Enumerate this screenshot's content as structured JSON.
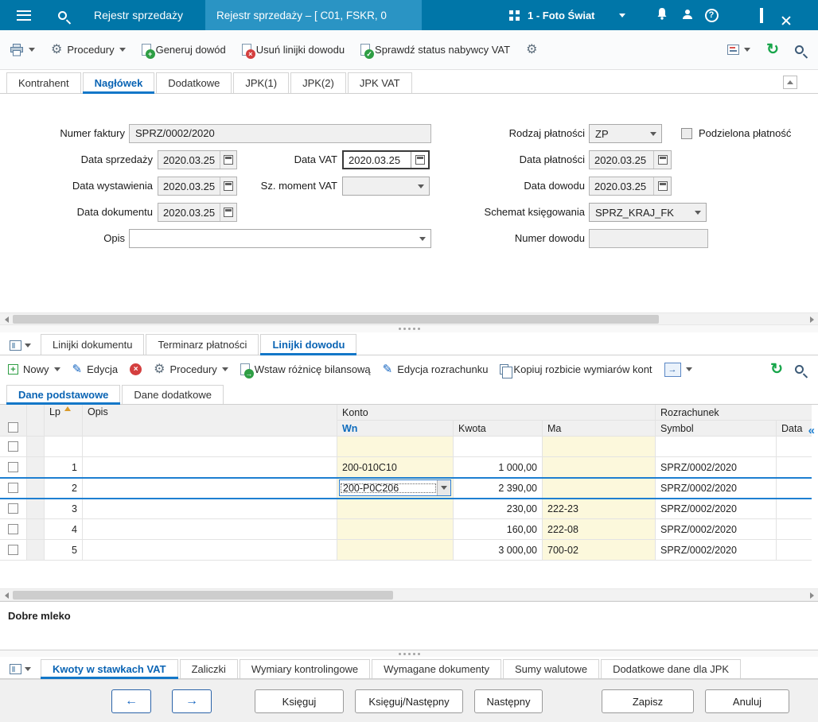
{
  "colors": {
    "titlebar": "#0076a8",
    "titlebar_active_tab": "#2a94c4",
    "accent_blue": "#1377c8",
    "selection_border": "#1e7fd1",
    "editable_cell_yellow": "#fcf8dc",
    "toolbar_green": "#2e9e44",
    "toolbar_red": "#d43f3f",
    "refresh_green": "#17a54a"
  },
  "titlebar": {
    "app_title": "Rejestr sprzedaży",
    "document_tab": "Rejestr sprzedaży – [ C01, FSKR, 0",
    "company": "1 - Foto Świat"
  },
  "toolbar": {
    "procedury": "Procedury",
    "generuj_dowod": "Generuj dowód",
    "usun_linijki_dowodu": "Usuń linijki dowodu",
    "sprawdz_status": "Sprawdź status nabywcy VAT"
  },
  "header_tabs": {
    "kontrahent": "Kontrahent",
    "naglowek": "Nagłówek",
    "dodatkowe": "Dodatkowe",
    "jpk1": "JPK(1)",
    "jpk2": "JPK(2)",
    "jpk_vat": "JPK VAT"
  },
  "form": {
    "numer_faktury_label": "Numer faktury",
    "numer_faktury_value": "SPRZ/0002/2020",
    "data_sprzedazy_label": "Data sprzedaży",
    "data_sprzedazy_value": "2020.03.25",
    "data_vat_label": "Data VAT",
    "data_vat_value": "2020.03.25",
    "data_wystawienia_label": "Data wystawienia",
    "data_wystawienia_value": "2020.03.25",
    "sz_moment_vat_label": "Sz. moment VAT",
    "sz_moment_vat_value": "",
    "data_dokumentu_label": "Data dokumentu",
    "data_dokumentu_value": "2020.03.25",
    "opis_label": "Opis",
    "opis_value": "",
    "rodzaj_platnosci_label": "Rodzaj płatności",
    "rodzaj_platnosci_value": "ZP",
    "podzielona_platnosc_label": "Podzielona płatność",
    "data_platnosci_label": "Data płatności",
    "data_platnosci_value": "2020.03.25",
    "data_dowodu_label": "Data dowodu",
    "data_dowodu_value": "2020.03.25",
    "schemat_ksiegowania_label": "Schemat księgowania",
    "schemat_ksiegowania_value": "SPRZ_KRAJ_FK",
    "numer_dowodu_label": "Numer dowodu",
    "numer_dowodu_value": ""
  },
  "middle_tabs": {
    "linijki_dokumentu": "Linijki dokumentu",
    "terminarz_platnosci": "Terminarz płatności",
    "linijki_dowodu": "Linijki dowodu"
  },
  "grid_toolbar": {
    "nowy": "Nowy",
    "edycja": "Edycja",
    "procedury": "Procedury",
    "wstaw_roznice": "Wstaw różnicę bilansową",
    "edycja_rozrachunku": "Edycja rozrachunku",
    "kopiuj_rozbicie": "Kopiuj rozbicie wymiarów kont"
  },
  "grid_subtabs": {
    "dane_podstawowe": "Dane podstawowe",
    "dane_dodatkowe": "Dane dodatkowe"
  },
  "grid": {
    "headers": {
      "lp": "Lp",
      "opis": "Opis",
      "konto": "Konto",
      "rozrachunek": "Rozrachunek",
      "wn": "Wn",
      "kwota": "Kwota",
      "ma": "Ma",
      "symbol": "Symbol",
      "data": "Data"
    },
    "rows": [
      {
        "lp": "1",
        "opis": "",
        "wn": "200-010C10",
        "kwota": "1 000,00",
        "ma": "",
        "symbol": "SPRZ/0002/2020"
      },
      {
        "lp": "2",
        "opis": "",
        "wn": "200-P0C206",
        "kwota": "2 390,00",
        "ma": "",
        "symbol": "SPRZ/0002/2020"
      },
      {
        "lp": "3",
        "opis": "",
        "wn": "",
        "kwota": "230,00",
        "ma": "222-23",
        "symbol": "SPRZ/0002/2020"
      },
      {
        "lp": "4",
        "opis": "",
        "wn": "",
        "kwota": "160,00",
        "ma": "222-08",
        "symbol": "SPRZ/0002/2020"
      },
      {
        "lp": "5",
        "opis": "",
        "wn": "",
        "kwota": "3 000,00",
        "ma": "700-02",
        "symbol": "SPRZ/0002/2020"
      }
    ],
    "note": "Dobre mleko"
  },
  "bottom_tabs": {
    "kwoty_vat": "Kwoty w stawkach VAT",
    "zaliczki": "Zaliczki",
    "wymiary": "Wymiary kontrolingowe",
    "wymagane": "Wymagane dokumenty",
    "sumy": "Sumy walutowe",
    "dodatkowe_jpk": "Dodatkowe dane dla JPK"
  },
  "footer_buttons": {
    "ksieguj": "Księguj",
    "ksieguj_nastepny": "Księguj/Następny",
    "nastepny": "Następny",
    "zapisz": "Zapisz",
    "anuluj": "Anuluj"
  }
}
